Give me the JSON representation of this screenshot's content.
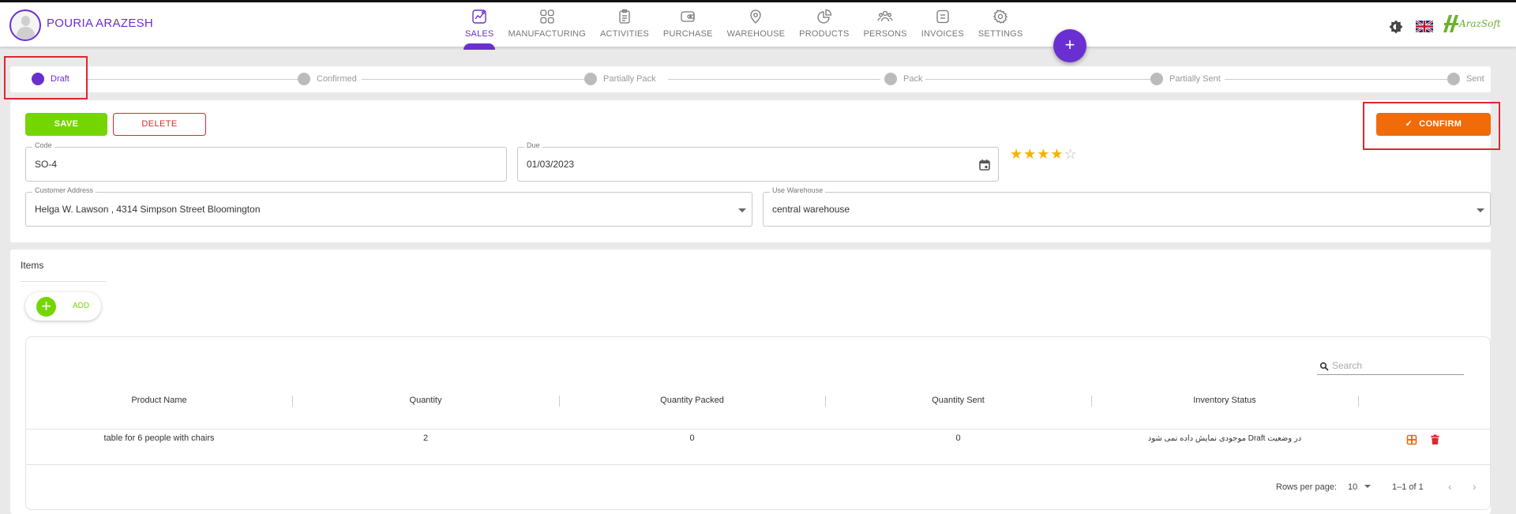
{
  "header": {
    "user_name": "POURIA ARAZESH",
    "logo_text": "ArazSoft",
    "fab_label": "+",
    "nav": [
      {
        "label": "SALES",
        "icon": "sales-chart-icon",
        "active": true
      },
      {
        "label": "MANUFACTURING",
        "icon": "manufacturing-grid-icon",
        "active": false
      },
      {
        "label": "ACTIVITIES",
        "icon": "activities-clipboard-icon",
        "active": false
      },
      {
        "label": "PURCHASE",
        "icon": "purchase-wallet-icon",
        "active": false
      },
      {
        "label": "WAREHOUSE",
        "icon": "warehouse-location-icon",
        "active": false
      },
      {
        "label": "PRODUCTS",
        "icon": "products-pie-icon",
        "active": false
      },
      {
        "label": "PERSONS",
        "icon": "persons-group-icon",
        "active": false
      },
      {
        "label": "INVOICES",
        "icon": "invoices-list-icon",
        "active": false
      },
      {
        "label": "SETTINGS",
        "icon": "settings-gear-icon",
        "active": false
      }
    ]
  },
  "stepper": {
    "steps": [
      "Draft",
      "Confirmed",
      "Partially Pack",
      "Pack",
      "Partially Sent",
      "Sent"
    ],
    "active_index": 0
  },
  "form": {
    "save_label": "SAVE",
    "delete_label": "DELETE",
    "confirm_label": "CONFIRM",
    "code": {
      "label": "Code",
      "value": "SO-4"
    },
    "due": {
      "label": "Due",
      "value": "01/03/2023"
    },
    "rating": {
      "value": 4,
      "max": 5
    },
    "customer_address": {
      "label": "Customer Address",
      "value": "Helga W. Lawson , 4314 Simpson Street Bloomington"
    },
    "warehouse": {
      "label": "Use Warehouse",
      "value": "central warehouse"
    }
  },
  "items": {
    "title": "Items",
    "add_label": "ADD",
    "search_placeholder": "Search",
    "columns": [
      "Product Name",
      "Quantity",
      "Quantity Packed",
      "Quantity Sent",
      "Inventory Status"
    ],
    "rows": [
      {
        "product_name": "table for 6 people with chairs",
        "quantity": "2",
        "quantity_packed": "0",
        "quantity_sent": "0",
        "inventory_status": "موجودی نمایش داده نمی شود Draft در وضعیت"
      }
    ],
    "footer": {
      "rows_per_page_label": "Rows per page:",
      "rows_per_page_value": "10",
      "range_label": "1–1 of 1"
    }
  },
  "colors": {
    "brand": "#6a2fd1",
    "save": "#74d500",
    "confirm": "#f06b0a",
    "delete": "#e0252f",
    "highlight_box": "#e0252f"
  }
}
